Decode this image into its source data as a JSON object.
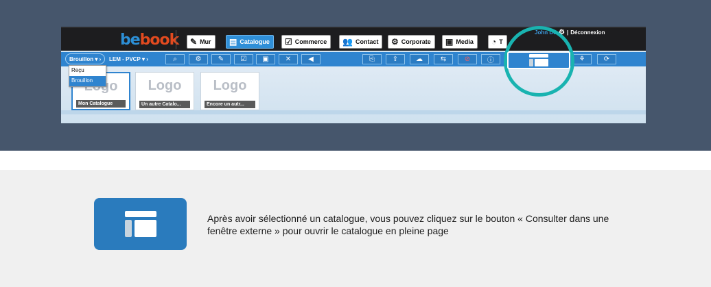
{
  "app": {
    "logo": {
      "part1": "be",
      "part2": "book"
    },
    "nav": [
      {
        "label": "Mur",
        "icon": "edit-icon"
      },
      {
        "label": "Catalogue",
        "icon": "catalog-icon",
        "active": true
      },
      {
        "label": "Commerce",
        "icon": "checklist-icon"
      },
      {
        "label": "Contact",
        "icon": "contacts-icon"
      },
      {
        "label": "Corporate",
        "icon": "corporate-icon"
      },
      {
        "label": "Media",
        "icon": "image-icon"
      },
      {
        "label": "T",
        "icon": "gauge-icon"
      }
    ],
    "user": {
      "name": "John Do",
      "logout": "Déconnexion",
      "separator": "|"
    },
    "breadcrumb": {
      "status": "Brouillon",
      "store": "LEM - PVCP"
    },
    "dropdown": {
      "options": [
        "Reçu",
        "Brouillon"
      ],
      "selected": "Brouillon"
    },
    "cards": [
      {
        "logo": "Logo",
        "name": "Mon Catalogue",
        "selected": true
      },
      {
        "logo": "Logo",
        "name": "Un autre Catalo..."
      },
      {
        "logo": "Logo",
        "name": "Encore un autr..."
      }
    ]
  },
  "explanation": {
    "text": "Après avoir sélectionné un catalogue, vous pouvez cliquez sur le bouton « Consulter dans une fenêtre externe » pour ouvrir le catalogue en pleine page"
  },
  "colors": {
    "slate": "#46566c",
    "accent": "#2f84cf",
    "highlight": "#19b3b0",
    "button": "#2a7bbd"
  }
}
